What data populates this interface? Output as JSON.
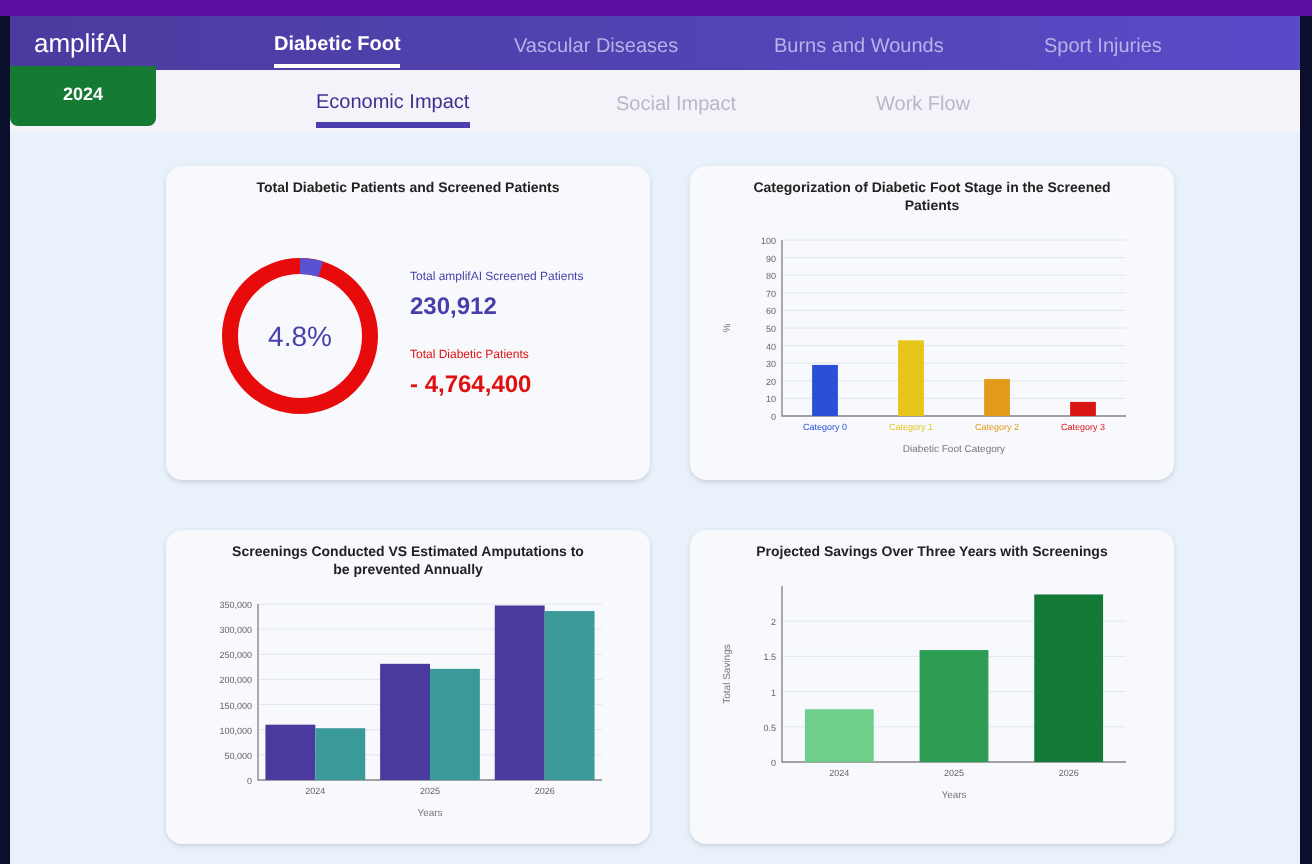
{
  "brand": "amplifAI",
  "nav_tabs": [
    {
      "label": "Diabetic Foot",
      "selected": true
    },
    {
      "label": "Vascular Diseases",
      "selected": false
    },
    {
      "label": "Burns and Wounds",
      "selected": false
    },
    {
      "label": "Sport Injuries",
      "selected": false
    }
  ],
  "year_badge": "2024",
  "sub_tabs": [
    {
      "label": "Economic Impact",
      "selected": true
    },
    {
      "label": "Social Impact",
      "selected": false
    },
    {
      "label": "Work Flow",
      "selected": false
    }
  ],
  "cards": [
    {
      "kind": "donut",
      "title": "Total Diabetic Patients and Screened Patients",
      "percent": "4.8%",
      "stats": [
        {
          "label": "Total amplifAI Screened Patients",
          "value": "230,912",
          "color": "#4a3fa8"
        },
        {
          "label": "Total Diabetic Patients",
          "value": "- 4,764,400",
          "color": "#e01010"
        }
      ]
    },
    {
      "kind": "chart",
      "title": "Categorization of Diabetic Foot Stage in the Screened Patients",
      "chart_data": {
        "type": "bar",
        "xlabel": "Diabetic Foot Category",
        "ylabel": "%",
        "categories": [
          "Category 0",
          "Category 1",
          "Category 2",
          "Category 3"
        ],
        "series": [
          {
            "color": "#2b4fd6",
            "values": [
              29,
              null,
              null,
              null
            ]
          },
          {
            "color": "#e6c619",
            "values": [
              null,
              43,
              null,
              null
            ]
          },
          {
            "color": "#e39a1a",
            "values": [
              null,
              null,
              21,
              null
            ]
          },
          {
            "color": "#d81414",
            "values": [
              null,
              null,
              null,
              8
            ]
          }
        ],
        "grid": true,
        "ylim": [
          0,
          100
        ],
        "yticks": [
          0,
          10,
          20,
          30,
          40,
          50,
          60,
          70,
          80,
          90,
          100
        ]
      }
    },
    {
      "kind": "chart",
      "title": "Screenings Conducted VS Estimated Amputations to be prevented Annually",
      "chart_data": {
        "type": "bar",
        "xlabel": "Years",
        "categories": [
          "2024",
          "2025",
          "2026"
        ],
        "series": [
          {
            "color": "#4b3a9e",
            "values": [
              110000,
              231000,
              347000
            ]
          },
          {
            "color": "#3a9a9a",
            "values": [
              103000,
              221000,
              336000
            ]
          }
        ],
        "grid": true,
        "ylim": [
          0,
          350000
        ],
        "yticks": [
          {
            "value": 0,
            "label": "0"
          },
          {
            "value": 50000,
            "label": "50,000"
          },
          {
            "value": 100000,
            "label": "100,000"
          },
          {
            "value": 150000,
            "label": "150,000"
          },
          {
            "value": 200000,
            "label": "200,000"
          },
          {
            "value": 250000,
            "label": "250,000"
          },
          {
            "value": 300000,
            "label": "300,000"
          },
          {
            "value": 350000,
            "label": "350,000"
          }
        ]
      }
    },
    {
      "kind": "chart",
      "title": "Projected Savings Over Three Years with Screenings",
      "chart_data": {
        "type": "bar",
        "xlabel": "Years",
        "ylabel": "Total Savings",
        "categories": [
          "2024",
          "2025",
          "2026"
        ],
        "series": [
          {
            "color": "#6fcf8a",
            "values": [
              0.75,
              null,
              null
            ]
          },
          {
            "color": "#2e9e55",
            "values": [
              null,
              1.59,
              null
            ]
          },
          {
            "color": "#137a37",
            "values": [
              null,
              null,
              2.38
            ]
          }
        ],
        "grid": true,
        "ylim": [
          0,
          2.5
        ],
        "yticks": [
          0,
          0.5,
          1,
          1.5,
          2
        ]
      }
    }
  ]
}
